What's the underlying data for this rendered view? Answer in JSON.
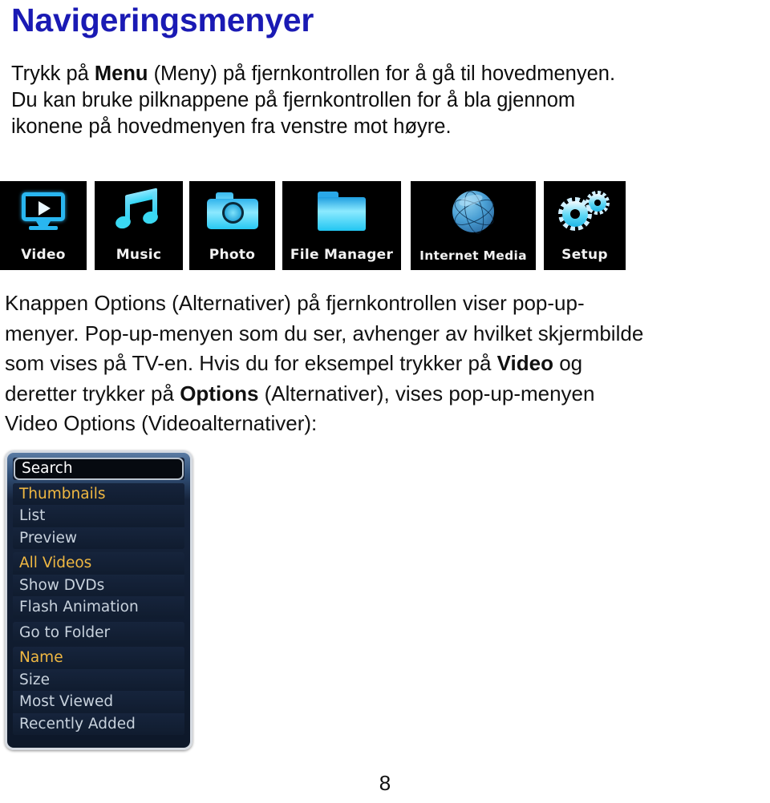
{
  "document": {
    "title": "Navigeringsmenyer",
    "title_color": "#1a1ab4",
    "page_number": "8"
  },
  "intro": {
    "line1_a": "Trykk på ",
    "line1_bold": "Menu",
    "line1_b": " (Meny) på fjernkontrollen for å gå til hovedmenyen.",
    "line2": "Du kan bruke pilknappene på fjernkontrollen for å bla gjennom",
    "line3": "ikonene på hovedmenyen fra venstre mot høyre."
  },
  "icon_strip": {
    "items": [
      {
        "label": "Video",
        "icon": "video-screen-play-icon"
      },
      {
        "label": "Music",
        "icon": "music-note-icon"
      },
      {
        "label": "Photo",
        "icon": "camera-icon"
      },
      {
        "label": "File Manager",
        "icon": "folder-icon"
      },
      {
        "label": "Internet Media",
        "icon": "globe-icon"
      },
      {
        "label": "Setup",
        "icon": "gears-icon"
      }
    ],
    "background": "#000000",
    "accent": "#2fc8f2"
  },
  "body_copy": {
    "line1": "Knappen Options (Alternativer) på fjernkontrollen viser pop-up-",
    "line2": "menyer. Pop-up-menyen som du ser, avhenger av hvilket skjermbilde",
    "line3_a": "som vises på TV-en. Hvis du for eksempel trykker på ",
    "line3_bold": "Video",
    "line3_b": " og",
    "line4_a": "deretter trykker på ",
    "line4_bold": "Options",
    "line4_b": " (Alternativer), vises pop-up-menyen",
    "line5": "Video Options (Videoalternativer):"
  },
  "popup_menu": {
    "name": "Video Options",
    "accent_color": "#f0b842",
    "text_color": "#c8d2dd",
    "groups": [
      {
        "items": [
          {
            "label": "Search",
            "state": "selected"
          }
        ]
      },
      {
        "items": [
          {
            "label": "Thumbnails",
            "state": "accent"
          },
          {
            "label": "List",
            "state": "normal"
          },
          {
            "label": "Preview",
            "state": "normal"
          }
        ]
      },
      {
        "items": [
          {
            "label": "All Videos",
            "state": "accent"
          },
          {
            "label": "Show DVDs",
            "state": "normal"
          },
          {
            "label": "Flash Animation",
            "state": "normal"
          }
        ]
      },
      {
        "items": [
          {
            "label": "Go to Folder",
            "state": "normal"
          }
        ]
      },
      {
        "items": [
          {
            "label": "Name",
            "state": "accent"
          },
          {
            "label": "Size",
            "state": "normal"
          },
          {
            "label": "Most Viewed",
            "state": "normal"
          },
          {
            "label": "Recently Added",
            "state": "normal"
          }
        ]
      }
    ]
  }
}
